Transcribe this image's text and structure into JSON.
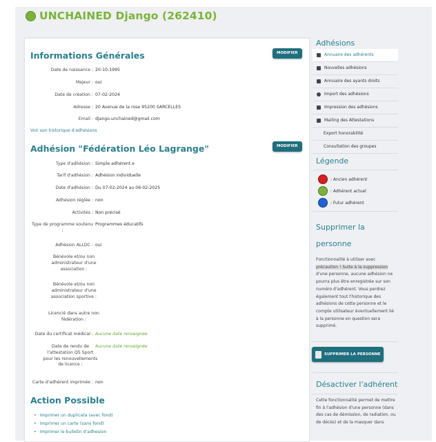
{
  "header": {
    "title": "UNCHAINED Django (262410)",
    "status_color": "#7bb33a"
  },
  "general": {
    "title": "Informations Générales",
    "modify_label": "MODIFIER",
    "fields": [
      {
        "label": "Date de naissance :",
        "value": "20-10-1995"
      },
      {
        "label": "Majeur :",
        "value": "oui"
      },
      {
        "label": "Date de création :",
        "value": "07-02-2024"
      },
      {
        "label": "Adresse :",
        "value": "20 Avenue de la rose 95200 SARCELLES"
      },
      {
        "label": "Email :",
        "value": "django.unchained@gmail.com"
      }
    ],
    "history_link": "Voir son historique d'adhésions"
  },
  "adhesion": {
    "title": "Adhésion \"Fédération Léo Lagrange\"",
    "modify_label": "MODIFIER",
    "fields": [
      {
        "label": "Type d'adhésion :",
        "value": "Simple adhérent.e"
      },
      {
        "label": "Tarif d'adhésion :",
        "value": "Adhésion individuelle"
      },
      {
        "label": "Date d'adhésion :",
        "value": "Du 07-02-2024 au 06-02-2025"
      },
      {
        "label": "Adhésion réglée :",
        "value": "non"
      },
      {
        "label": "Activités :",
        "value": "Non précisé"
      },
      {
        "label": "Type de programme soutenu :",
        "value": "Programmes éducatifs"
      },
      {
        "label": "Adhésion ALLDC :",
        "value": "oui"
      },
      {
        "label": "Bénévole et/ou non administrateur d'une association :",
        "value": ""
      },
      {
        "label": "Bénévole et/ou non administrateur d'une association sportive :",
        "value": ""
      },
      {
        "label": "Licencié dans autre non fédération :",
        "value": ""
      },
      {
        "label": "Date du certificat médical :",
        "value": "Aucune date renseignée"
      },
      {
        "label": "Date de rendu de l'attestation QS Sport pour les renouvellements de licence :",
        "value": "Aucune date renseignée"
      },
      {
        "label": "Carte d'adhérent imprimée :",
        "value": "non"
      }
    ]
  },
  "actions": {
    "title": "Action Possible",
    "items": [
      "Imprimer un duplicata (avec fond)",
      "Imprimer un carte (sans fond)",
      "Imprimer le bulletin d'adhesion"
    ]
  },
  "sidebar": {
    "adhesions_title": "Adhésions",
    "menu": [
      {
        "label": "Annuaire des adhérents",
        "icon": "address-book-icon"
      },
      {
        "label": "Nouvelles adhésions",
        "icon": "file-icon"
      },
      {
        "label": "Annuaire des ayants droits",
        "icon": "address-book-icon"
      },
      {
        "label": "Import des adhésions",
        "icon": "import-icon"
      },
      {
        "label": "Impression des adhésions",
        "icon": "print-icon"
      },
      {
        "label": "Mailing des Attestations",
        "icon": "envelope-icon"
      },
      {
        "label": "Export honorabilité",
        "icon": ""
      },
      {
        "label": "Consultation des groupes",
        "icon": ""
      }
    ],
    "legend_title": "Légende",
    "legend": [
      {
        "label": ": Ancien adhérent",
        "color": "#d42020"
      },
      {
        "label": ": Adhérent actuel",
        "color": "#7bb33a"
      },
      {
        "label": ": Futur adhérent",
        "color": "#1f63d1"
      }
    ],
    "delete_title": "Supprimer la personne",
    "delete_text_1": "Fonctionnalité à utiliser avec",
    "delete_text_hl": "précaution ! Suite à la suppression",
    "delete_text_2": "d'une personne, aucune adhésion ne pourra plus être enregistrée sur son numéro d'adhérent. Vous perdrez également tout l'historique des adhésions de cette personne et le compte utilisateur éventuellement lié à la personne en question sera supprimé.",
    "delete_button": "SUPPRIMER LA PERSONNE",
    "deactivate_title": "Désactiver l'adhérent",
    "deactivate_text": "Cette fonctionnalité permet de mettre fin à l'adhésion d'une personne (dans des cas de démission, de radiation, ou de décès) et de la masquer dans"
  }
}
